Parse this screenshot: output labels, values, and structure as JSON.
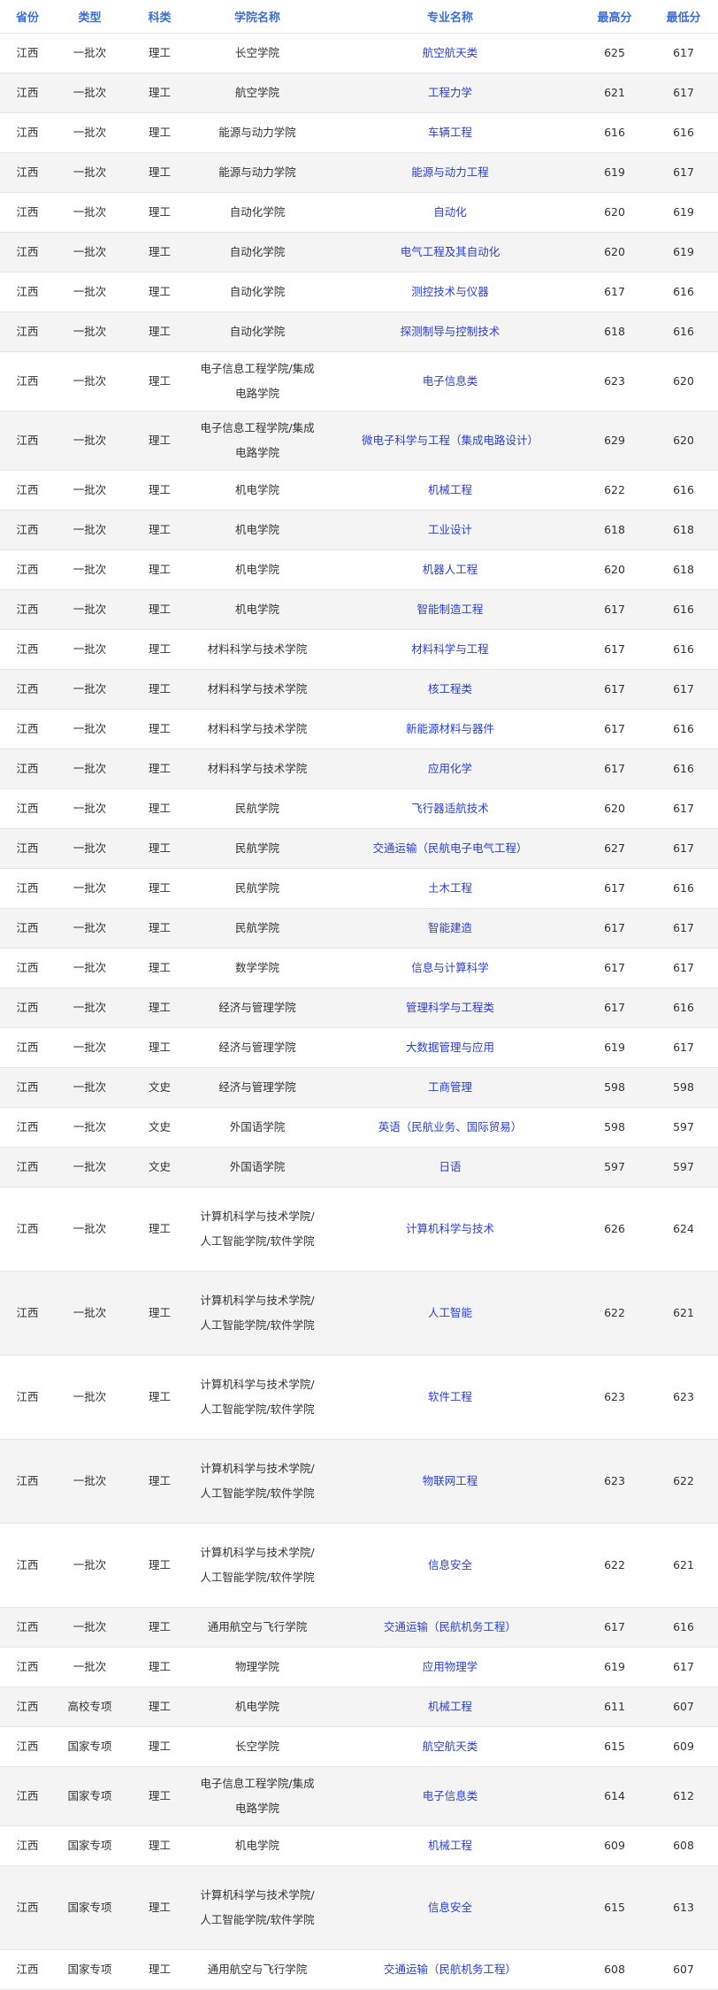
{
  "table": {
    "headers": {
      "province": "省份",
      "type": "类型",
      "category": "科类",
      "college": "学院名称",
      "major": "专业名称",
      "max_score": "最高分",
      "min_score": "最低分"
    },
    "rows": [
      {
        "province": "江西",
        "type": "一批次",
        "category": "理工",
        "college": "长空学院",
        "major": "航空航天类",
        "max": "625",
        "min": "617"
      },
      {
        "province": "江西",
        "type": "一批次",
        "category": "理工",
        "college": "航空学院",
        "major": "工程力学",
        "max": "621",
        "min": "617"
      },
      {
        "province": "江西",
        "type": "一批次",
        "category": "理工",
        "college": "能源与动力学院",
        "major": "车辆工程",
        "max": "616",
        "min": "616"
      },
      {
        "province": "江西",
        "type": "一批次",
        "category": "理工",
        "college": "能源与动力学院",
        "major": "能源与动力工程",
        "max": "619",
        "min": "617"
      },
      {
        "province": "江西",
        "type": "一批次",
        "category": "理工",
        "college": "自动化学院",
        "major": "自动化",
        "max": "620",
        "min": "619"
      },
      {
        "province": "江西",
        "type": "一批次",
        "category": "理工",
        "college": "自动化学院",
        "major": "电气工程及其自动化",
        "max": "620",
        "min": "619"
      },
      {
        "province": "江西",
        "type": "一批次",
        "category": "理工",
        "college": "自动化学院",
        "major": "测控技术与仪器",
        "max": "617",
        "min": "616"
      },
      {
        "province": "江西",
        "type": "一批次",
        "category": "理工",
        "college": "自动化学院",
        "major": "探测制导与控制技术",
        "max": "618",
        "min": "616"
      },
      {
        "province": "江西",
        "type": "一批次",
        "category": "理工",
        "college": "电子信息工程学院/集成电路学院",
        "major": "电子信息类",
        "max": "623",
        "min": "620"
      },
      {
        "province": "江西",
        "type": "一批次",
        "category": "理工",
        "college": "电子信息工程学院/集成电路学院",
        "major": "微电子科学与工程（集成电路设计）",
        "max": "629",
        "min": "620"
      },
      {
        "province": "江西",
        "type": "一批次",
        "category": "理工",
        "college": "机电学院",
        "major": "机械工程",
        "max": "622",
        "min": "616"
      },
      {
        "province": "江西",
        "type": "一批次",
        "category": "理工",
        "college": "机电学院",
        "major": "工业设计",
        "max": "618",
        "min": "618"
      },
      {
        "province": "江西",
        "type": "一批次",
        "category": "理工",
        "college": "机电学院",
        "major": "机器人工程",
        "max": "620",
        "min": "618"
      },
      {
        "province": "江西",
        "type": "一批次",
        "category": "理工",
        "college": "机电学院",
        "major": "智能制造工程",
        "max": "617",
        "min": "616"
      },
      {
        "province": "江西",
        "type": "一批次",
        "category": "理工",
        "college": "材料科学与技术学院",
        "major": "材料科学与工程",
        "max": "617",
        "min": "616"
      },
      {
        "province": "江西",
        "type": "一批次",
        "category": "理工",
        "college": "材料科学与技术学院",
        "major": "核工程类",
        "max": "617",
        "min": "617"
      },
      {
        "province": "江西",
        "type": "一批次",
        "category": "理工",
        "college": "材料科学与技术学院",
        "major": "新能源材料与器件",
        "max": "617",
        "min": "616"
      },
      {
        "province": "江西",
        "type": "一批次",
        "category": "理工",
        "college": "材料科学与技术学院",
        "major": "应用化学",
        "max": "617",
        "min": "616"
      },
      {
        "province": "江西",
        "type": "一批次",
        "category": "理工",
        "college": "民航学院",
        "major": "飞行器适航技术",
        "max": "620",
        "min": "617"
      },
      {
        "province": "江西",
        "type": "一批次",
        "category": "理工",
        "college": "民航学院",
        "major": "交通运输（民航电子电气工程）",
        "max": "627",
        "min": "617"
      },
      {
        "province": "江西",
        "type": "一批次",
        "category": "理工",
        "college": "民航学院",
        "major": "土木工程",
        "max": "617",
        "min": "616"
      },
      {
        "province": "江西",
        "type": "一批次",
        "category": "理工",
        "college": "民航学院",
        "major": "智能建造",
        "max": "617",
        "min": "617"
      },
      {
        "province": "江西",
        "type": "一批次",
        "category": "理工",
        "college": "数学学院",
        "major": "信息与计算科学",
        "max": "617",
        "min": "617"
      },
      {
        "province": "江西",
        "type": "一批次",
        "category": "理工",
        "college": "经济与管理学院",
        "major": "管理科学与工程类",
        "max": "617",
        "min": "616"
      },
      {
        "province": "江西",
        "type": "一批次",
        "category": "理工",
        "college": "经济与管理学院",
        "major": "大数据管理与应用",
        "max": "619",
        "min": "617"
      },
      {
        "province": "江西",
        "type": "一批次",
        "category": "文史",
        "college": "经济与管理学院",
        "major": "工商管理",
        "max": "598",
        "min": "598"
      },
      {
        "province": "江西",
        "type": "一批次",
        "category": "文史",
        "college": "外国语学院",
        "major": "英语（民航业务、国际贸易）",
        "max": "598",
        "min": "597"
      },
      {
        "province": "江西",
        "type": "一批次",
        "category": "文史",
        "college": "外国语学院",
        "major": "日语",
        "max": "597",
        "min": "597"
      },
      {
        "province": "江西",
        "type": "一批次",
        "category": "理工",
        "college": "计算机科学与技术学院/人工智能学院/软件学院",
        "major": "计算机科学与技术",
        "max": "626",
        "min": "624"
      },
      {
        "province": "江西",
        "type": "一批次",
        "category": "理工",
        "college": "计算机科学与技术学院/人工智能学院/软件学院",
        "major": "人工智能",
        "max": "622",
        "min": "621"
      },
      {
        "province": "江西",
        "type": "一批次",
        "category": "理工",
        "college": "计算机科学与技术学院/人工智能学院/软件学院",
        "major": "软件工程",
        "max": "623",
        "min": "623"
      },
      {
        "province": "江西",
        "type": "一批次",
        "category": "理工",
        "college": "计算机科学与技术学院/人工智能学院/软件学院",
        "major": "物联网工程",
        "max": "623",
        "min": "622"
      },
      {
        "province": "江西",
        "type": "一批次",
        "category": "理工",
        "college": "计算机科学与技术学院/人工智能学院/软件学院",
        "major": "信息安全",
        "max": "622",
        "min": "621"
      },
      {
        "province": "江西",
        "type": "一批次",
        "category": "理工",
        "college": "通用航空与飞行学院",
        "major": "交通运输（民航机务工程）",
        "max": "617",
        "min": "616"
      },
      {
        "province": "江西",
        "type": "一批次",
        "category": "理工",
        "college": "物理学院",
        "major": "应用物理学",
        "max": "619",
        "min": "617"
      },
      {
        "province": "江西",
        "type": "高校专项",
        "category": "理工",
        "college": "机电学院",
        "major": "机械工程",
        "max": "611",
        "min": "607"
      },
      {
        "province": "江西",
        "type": "国家专项",
        "category": "理工",
        "college": "长空学院",
        "major": "航空航天类",
        "max": "615",
        "min": "609"
      },
      {
        "province": "江西",
        "type": "国家专项",
        "category": "理工",
        "college": "电子信息工程学院/集成电路学院",
        "major": "电子信息类",
        "max": "614",
        "min": "612"
      },
      {
        "province": "江西",
        "type": "国家专项",
        "category": "理工",
        "college": "机电学院",
        "major": "机械工程",
        "max": "609",
        "min": "608"
      },
      {
        "province": "江西",
        "type": "国家专项",
        "category": "理工",
        "college": "计算机科学与技术学院/人工智能学院/软件学院",
        "major": "信息安全",
        "max": "615",
        "min": "613"
      },
      {
        "province": "江西",
        "type": "国家专项",
        "category": "理工",
        "college": "通用航空与飞行学院",
        "major": "交通运输（民航机务工程）",
        "max": "608",
        "min": "607"
      }
    ]
  }
}
